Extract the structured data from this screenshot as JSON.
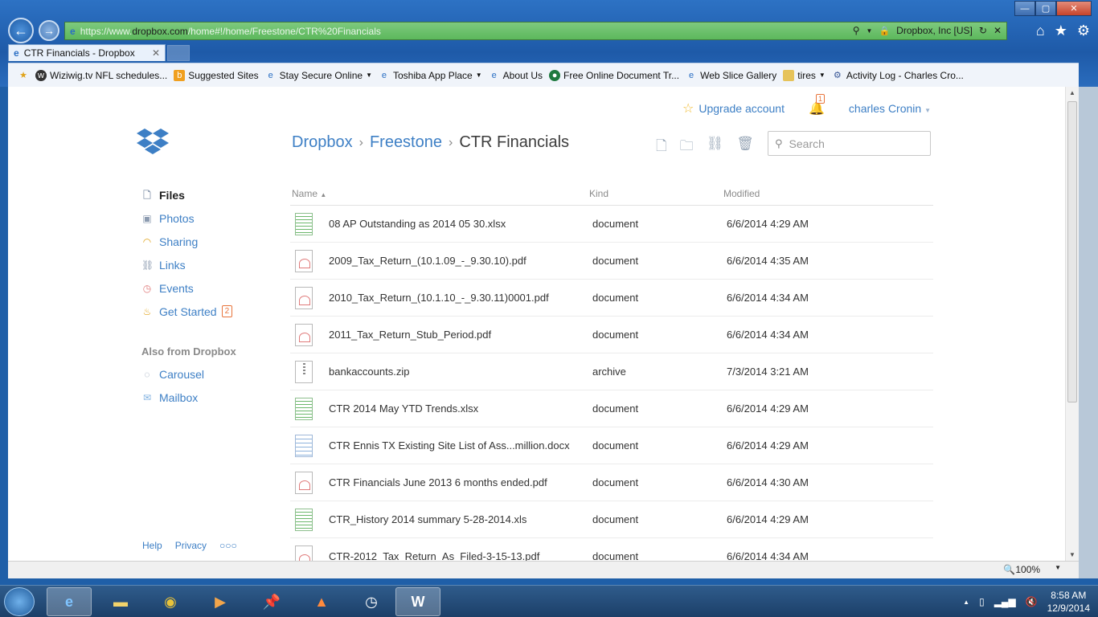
{
  "browser": {
    "url_scheme": "https://www.",
    "url_domain": "dropbox.com",
    "url_path": "/home#!/home/Freestone/CTR%20Financials",
    "cert_label": "Dropbox, Inc [US]",
    "tab_title": "CTR Financials - Dropbox",
    "favorites": [
      {
        "label": "Wiziwig.tv  NFL schedules...",
        "icon": "wiziwig-icon"
      },
      {
        "label": "Suggested Sites",
        "icon": "suggested-sites-icon"
      },
      {
        "label": "Stay Secure Online",
        "icon": "ie-page-icon",
        "dropdown": true
      },
      {
        "label": "Toshiba App Place",
        "icon": "ie-page-icon",
        "dropdown": true
      },
      {
        "label": "About Us",
        "icon": "ie-page-icon"
      },
      {
        "label": "Free Online Document Tr...",
        "icon": "globe-icon"
      },
      {
        "label": "Web Slice Gallery",
        "icon": "ie-page-icon"
      },
      {
        "label": "tires",
        "icon": "folder-icon",
        "dropdown": true
      },
      {
        "label": "Activity Log - Charles Cro...",
        "icon": "activity-icon"
      }
    ],
    "zoom": "100%"
  },
  "header": {
    "upgrade_label": "Upgrade account",
    "notification_count": "1",
    "user_name": "charles Cronin",
    "search_placeholder": "Search"
  },
  "breadcrumb": {
    "root": "Dropbox",
    "parent": "Freestone",
    "current": "CTR Financials"
  },
  "sidebar": {
    "items": [
      {
        "label": "Files",
        "icon": "files-icon",
        "active": true
      },
      {
        "label": "Photos",
        "icon": "photos-icon"
      },
      {
        "label": "Sharing",
        "icon": "sharing-icon"
      },
      {
        "label": "Links",
        "icon": "link-icon"
      },
      {
        "label": "Events",
        "icon": "events-icon"
      },
      {
        "label": "Get Started",
        "icon": "get-started-icon",
        "count": "2"
      }
    ],
    "also_heading": "Also from Dropbox",
    "also_items": [
      {
        "label": "Carousel",
        "icon": "carousel-icon"
      },
      {
        "label": "Mailbox",
        "icon": "mailbox-icon"
      }
    ],
    "footer": {
      "help": "Help",
      "privacy": "Privacy",
      "more": "○○○"
    }
  },
  "table": {
    "columns": {
      "name": "Name",
      "kind": "Kind",
      "modified": "Modified"
    },
    "rows": [
      {
        "name": "08 AP Outstanding as 2014 05 30.xlsx",
        "kind": "document",
        "modified": "6/6/2014 4:29 AM",
        "icon": "xls"
      },
      {
        "name": "2009_Tax_Return_(10.1.09_-_9.30.10).pdf",
        "kind": "document",
        "modified": "6/6/2014 4:35 AM",
        "icon": "pdf"
      },
      {
        "name": "2010_Tax_Return_(10.1.10_-_9.30.11)0001.pdf",
        "kind": "document",
        "modified": "6/6/2014 4:34 AM",
        "icon": "pdf"
      },
      {
        "name": "2011_Tax_Return_Stub_Period.pdf",
        "kind": "document",
        "modified": "6/6/2014 4:34 AM",
        "icon": "pdf"
      },
      {
        "name": "bankaccounts.zip",
        "kind": "archive",
        "modified": "7/3/2014 3:21 AM",
        "icon": "zip"
      },
      {
        "name": "CTR 2014 May YTD Trends.xlsx",
        "kind": "document",
        "modified": "6/6/2014 4:29 AM",
        "icon": "xls"
      },
      {
        "name": "CTR Ennis TX Existing Site List of Ass...million.docx",
        "kind": "document",
        "modified": "6/6/2014 4:29 AM",
        "icon": "doc"
      },
      {
        "name": "CTR Financials June 2013 6 months ended.pdf",
        "kind": "document",
        "modified": "6/6/2014 4:30 AM",
        "icon": "pdf"
      },
      {
        "name": "CTR_History 2014 summary 5-28-2014.xls",
        "kind": "document",
        "modified": "6/6/2014 4:29 AM",
        "icon": "xls"
      },
      {
        "name": "CTR-2012_Tax_Return_As_Filed-3-15-13.pdf",
        "kind": "document",
        "modified": "6/6/2014 4:34 AM",
        "icon": "pdf"
      }
    ]
  },
  "taskbar": {
    "time": "8:58 AM",
    "date": "12/9/2014"
  },
  "colors": {
    "link_blue": "#3d7fc5",
    "addr_green": "#5cb85c",
    "badge_orange": "#e8743b"
  }
}
